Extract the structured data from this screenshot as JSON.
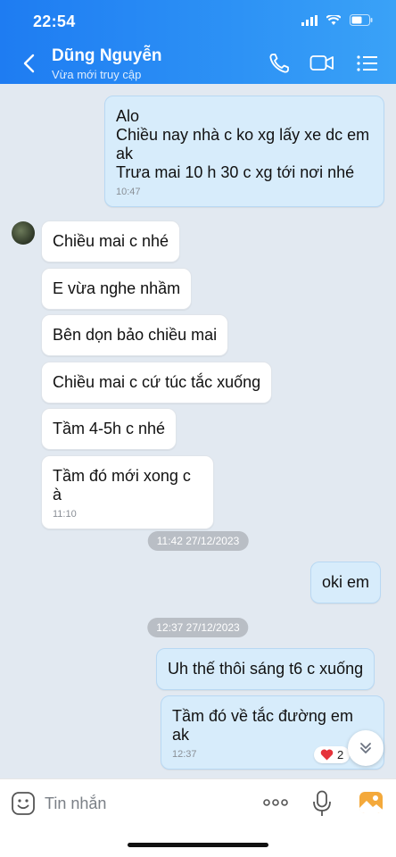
{
  "status": {
    "time": "22:54"
  },
  "header": {
    "contact_name": "Dũng Nguyễn",
    "contact_status": "Vừa mới truy cập",
    "icons": [
      "back-icon",
      "phone-icon",
      "video-icon",
      "menu-icon"
    ]
  },
  "messages": {
    "m1": {
      "lines": [
        "Alo",
        "Chiều nay nhà c ko xg lấy xe dc em",
        "ak",
        "Trưa mai 10 h 30 c xg tới nơi nhé"
      ],
      "time": "10:47"
    },
    "m2": {
      "text": "Chiều mai c nhé"
    },
    "m3": {
      "text": "E vừa nghe nhầm"
    },
    "m4": {
      "text": "Bên dọn bảo chiều mai"
    },
    "m5": {
      "text": "Chiều mai c cứ túc tắc xuống"
    },
    "m6": {
      "text": "Tầm 4-5h c nhé"
    },
    "m7": {
      "text": "Tầm đó mới xong c à",
      "time": "11:10"
    },
    "d1": "11:42 27/12/2023",
    "m8": {
      "text": "oki em"
    },
    "d2": "12:37 27/12/2023",
    "m9": {
      "text": "Uh thế thôi sáng t6 c xuống"
    },
    "m10": {
      "text": "Tầm đó về tắc đường em ak",
      "time": "12:37"
    },
    "reaction_count": "2"
  },
  "input": {
    "placeholder": "Tin nhắn"
  },
  "colors": {
    "header_start": "#1e7cf2",
    "outgoing_bubble": "#d7ecfb",
    "incoming_bubble": "#ffffff",
    "chat_bg": "#e2e9f1",
    "reaction_heart": "#e5333b"
  }
}
